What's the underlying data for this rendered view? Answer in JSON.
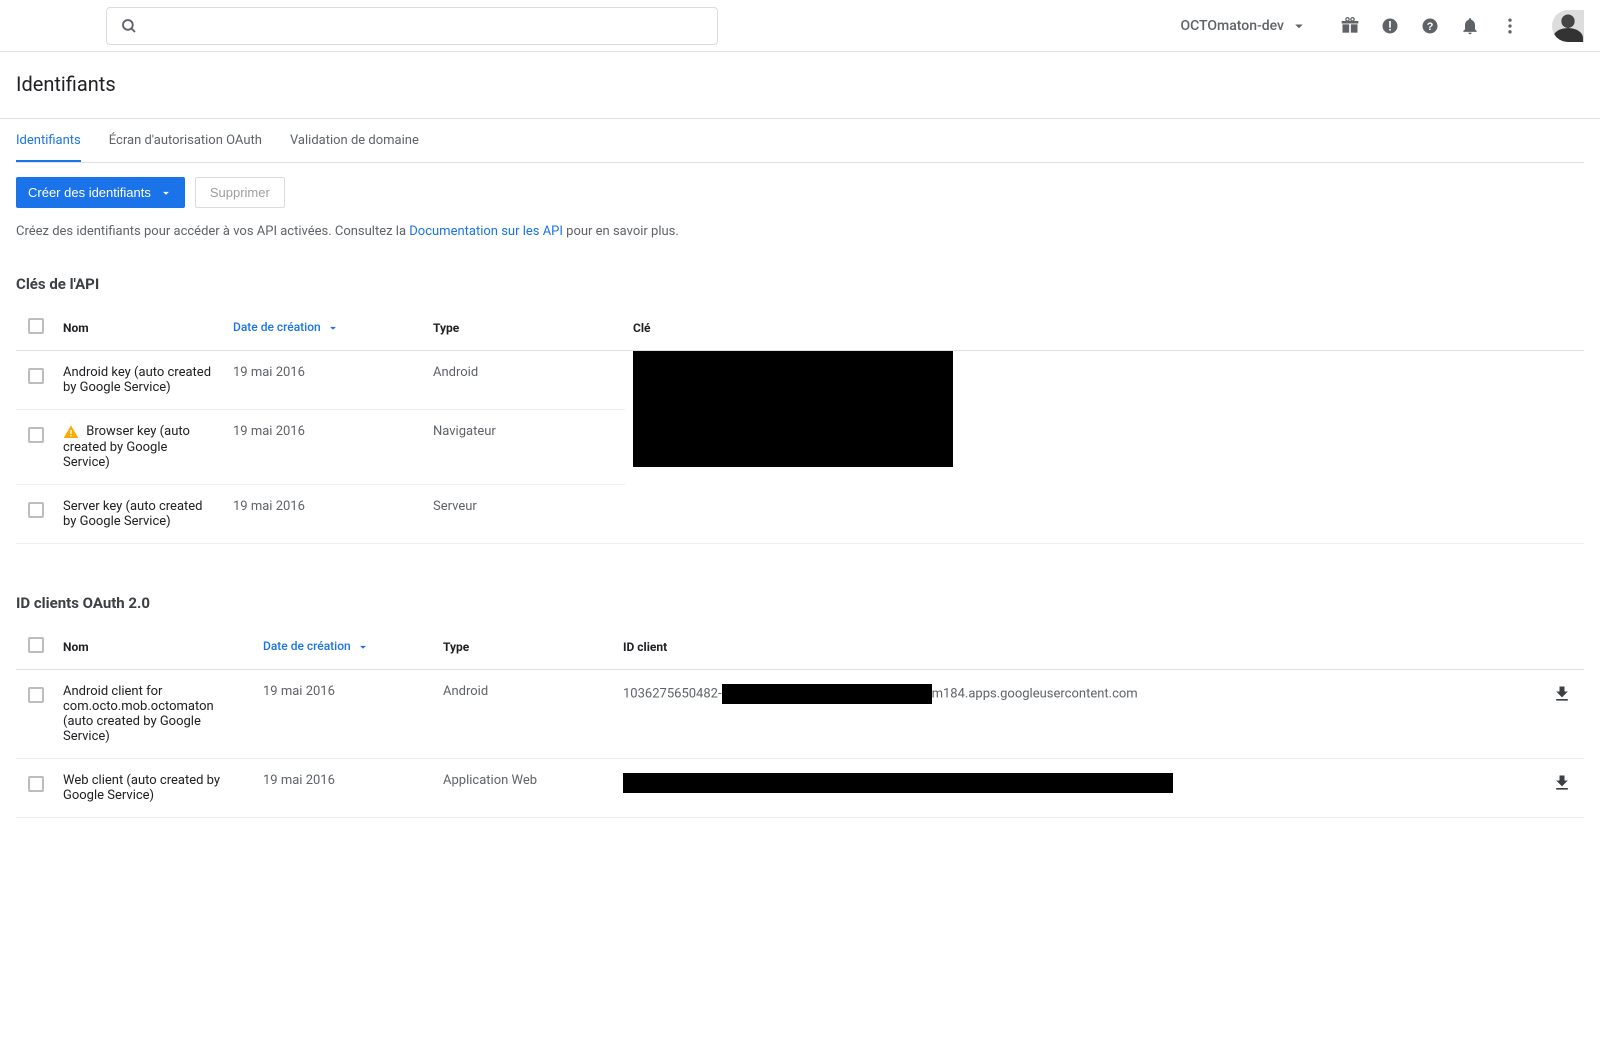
{
  "header": {
    "project_name": "OCTOmaton-dev"
  },
  "page": {
    "title": "Identifiants"
  },
  "tabs": [
    {
      "label": "Identifiants",
      "active": true
    },
    {
      "label": "Écran d'autorisation OAuth",
      "active": false
    },
    {
      "label": "Validation de domaine",
      "active": false
    }
  ],
  "actions": {
    "create_label": "Créer des identifiants",
    "delete_label": "Supprimer"
  },
  "help": {
    "prefix": "Créez des identifiants pour accéder à vos API activées. Consultez la ",
    "link_text": "Documentation sur les API",
    "suffix": " pour en savoir plus."
  },
  "api_keys": {
    "section_title": "Clés de l'API",
    "columns": {
      "name": "Nom",
      "date": "Date de création",
      "type": "Type",
      "key": "Clé"
    },
    "rows": [
      {
        "name": "Android key (auto created by Google Service)",
        "date": "19 mai 2016",
        "type": "Android",
        "warn": false
      },
      {
        "name": "Browser key (auto created by Google Service)",
        "date": "19 mai 2016",
        "type": "Navigateur",
        "warn": true
      },
      {
        "name": "Server key (auto created by Google Service)",
        "date": "19 mai 2016",
        "type": "Serveur",
        "warn": false
      }
    ]
  },
  "oauth_clients": {
    "section_title": "ID clients OAuth 2.0",
    "columns": {
      "name": "Nom",
      "date": "Date de création",
      "type": "Type",
      "client_id": "ID client"
    },
    "rows": [
      {
        "name": "Android client for com.octo.mob.octomaton (auto created by Google Service)",
        "date": "19 mai 2016",
        "type": "Android",
        "client_id_prefix": "1036275650482-",
        "client_id_suffix": "m184.apps.googleusercontent.com"
      },
      {
        "name": "Web client (auto created by Google Service)",
        "date": "19 mai 2016",
        "type": "Application Web",
        "client_id_prefix": "",
        "client_id_suffix": ""
      }
    ]
  }
}
